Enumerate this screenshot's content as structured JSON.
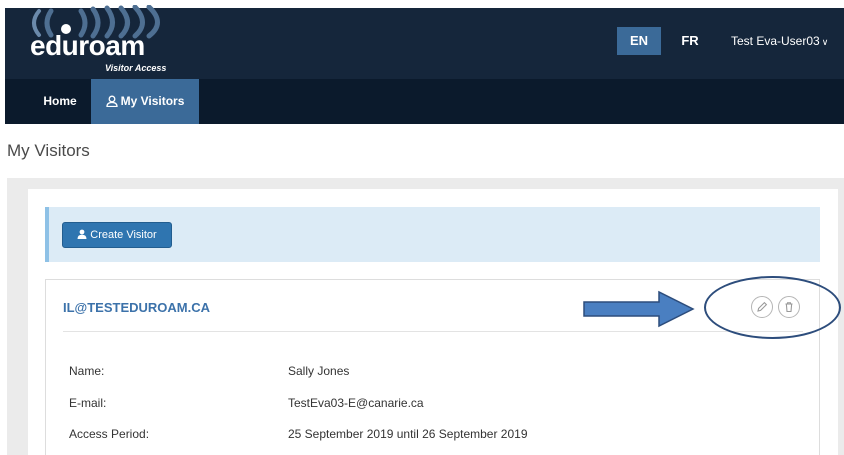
{
  "header": {
    "logo_word": "eduroam",
    "logo_subtitle": "Visitor Access",
    "languages": [
      {
        "code": "EN",
        "active": true
      },
      {
        "code": "FR",
        "active": false
      }
    ],
    "user_name": "Test Eva-User03"
  },
  "nav": {
    "items": [
      {
        "label": "Home",
        "active": false
      },
      {
        "label": "My Visitors",
        "active": true
      }
    ]
  },
  "page": {
    "title": "My Visitors"
  },
  "toolbar": {
    "create_label": "Create Visitor"
  },
  "visitor": {
    "id": "IL@TESTEDUROAM.CA",
    "fields": [
      {
        "label": "Name:",
        "value": "Sally Jones"
      },
      {
        "label": "E-mail:",
        "value": "TestEva03-E@canarie.ca"
      },
      {
        "label": "Access Period:",
        "value": "25 September 2019 until 26 September 2019"
      }
    ]
  },
  "colors": {
    "header_bg": "#15263b",
    "nav_bg": "#0b1a2c",
    "accent": "#3b6a98",
    "button": "#2f75b0",
    "link": "#3c72aa",
    "toolbar_bg": "#dcebf6",
    "annotation": "#2d4d7c",
    "arrow_fill": "#4a7fc1"
  },
  "icons": {
    "logo_waves": "wifi-waves-icon",
    "user": "user-icon",
    "visitors": "person-outline-icon",
    "edit": "pencil-icon",
    "delete": "trash-icon",
    "dropdown": "chevron-down-icon"
  }
}
